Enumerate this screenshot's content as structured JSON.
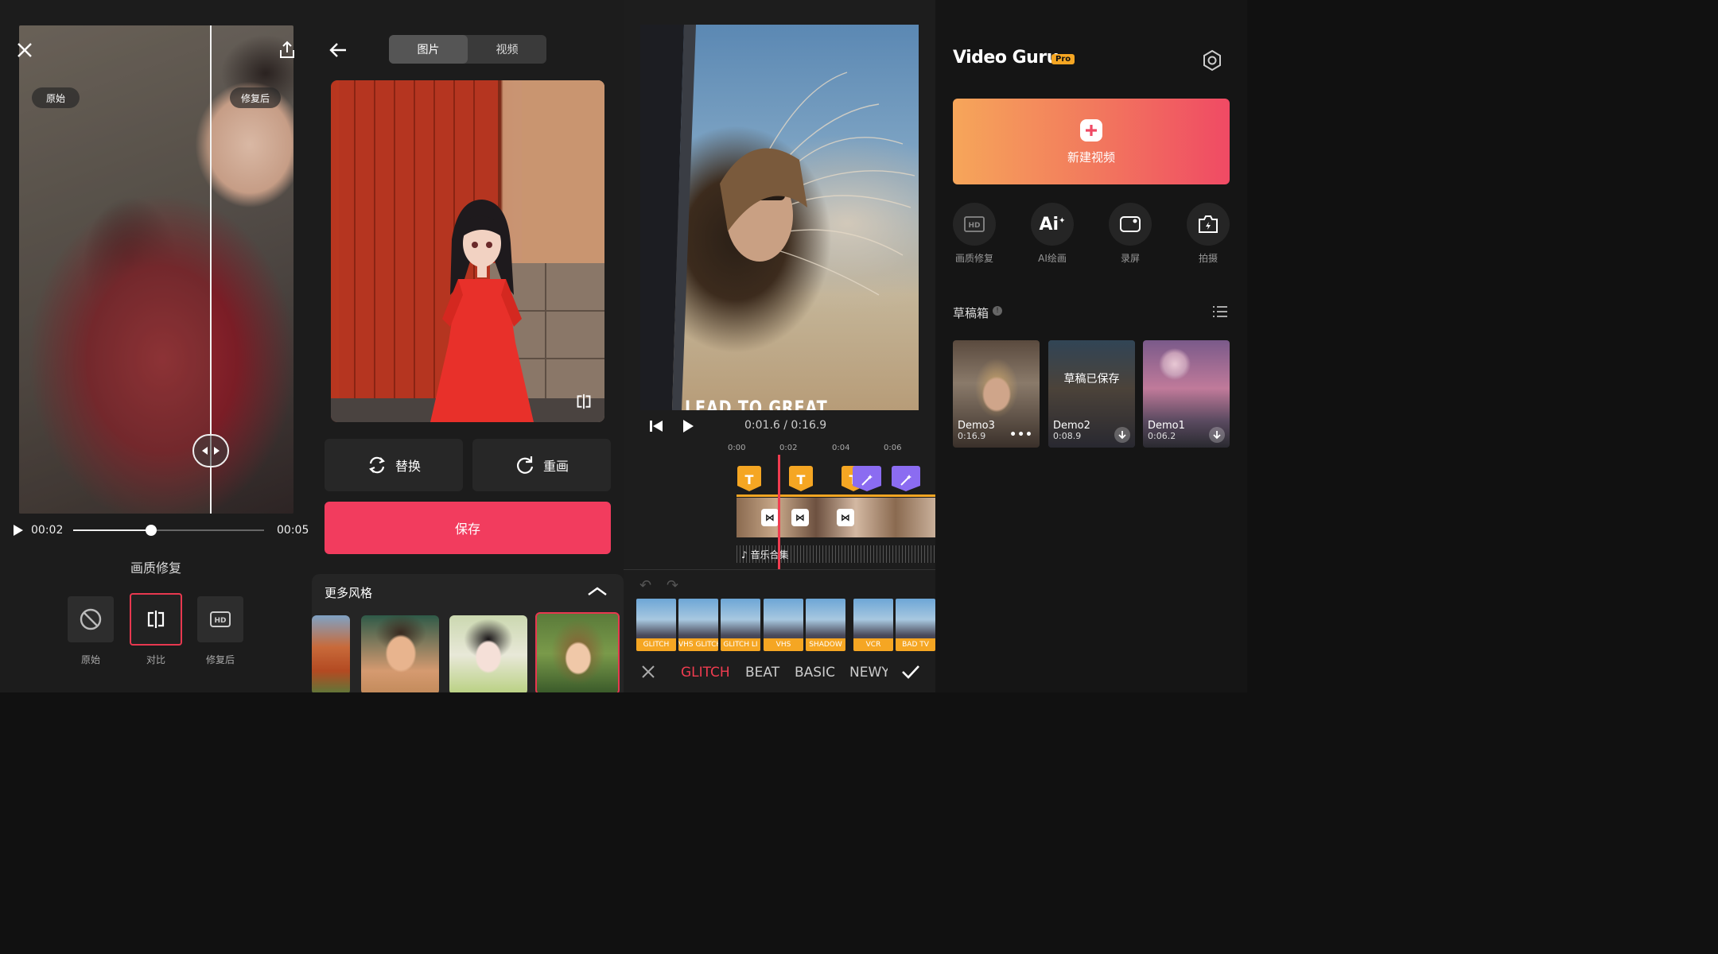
{
  "restore": {
    "before_tag": "原始",
    "after_tag": "修复后",
    "time_current": "00:02",
    "time_total": "00:05",
    "progress": 0.41,
    "title": "画质修复",
    "tools": [
      {
        "label": "原始",
        "icon": "no-icon"
      },
      {
        "label": "对比",
        "icon": "compare-icon",
        "selected": true
      },
      {
        "label": "修复后",
        "icon": "hd-icon"
      }
    ]
  },
  "ai_art": {
    "tab_photo": "图片",
    "tab_video": "视频",
    "replace_label": "替换",
    "redraw_label": "重画",
    "save_label": "保存",
    "more_styles_label": "更多风格"
  },
  "editor": {
    "caption": "LEAD TO GREAT",
    "time_current": "0:01.6",
    "time_total": "0:16.9",
    "ruler": [
      "0:00",
      "0:02",
      "0:04",
      "0:06"
    ],
    "music_label": "音乐合集",
    "effects": [
      "GLITCH",
      "VHS GLITCH",
      "GLITCH LI",
      "VHS",
      "SHADOW",
      "VCR",
      "BAD TV"
    ],
    "tabs": [
      "GLITCH",
      "BEAT",
      "BASIC",
      "NEWY"
    ],
    "active_tab": "GLITCH"
  },
  "home": {
    "app_name": "Video Guru",
    "pro_badge": "Pro",
    "new_video_label": "新建视频",
    "quick_actions": [
      {
        "label": "画质修复",
        "icon": "hd-icon"
      },
      {
        "label": "AI绘画",
        "icon": "ai-icon"
      },
      {
        "label": "录屏",
        "icon": "record-icon"
      },
      {
        "label": "拍摄",
        "icon": "camera-icon"
      }
    ],
    "drafts_label": "草稿箱",
    "drafts": [
      {
        "name": "Demo3",
        "duration": "0:16.9"
      },
      {
        "name": "Demo2",
        "duration": "0:08.9",
        "overlay": "草稿已保存"
      },
      {
        "name": "Demo1",
        "duration": "0:06.2"
      }
    ],
    "accent_gradient": [
      "#f6a65a",
      "#f04a64"
    ]
  },
  "colors": {
    "accent_red": "#f23c5e",
    "marker_orange": "#f5a623",
    "marker_purple": "#8b6cf1"
  }
}
